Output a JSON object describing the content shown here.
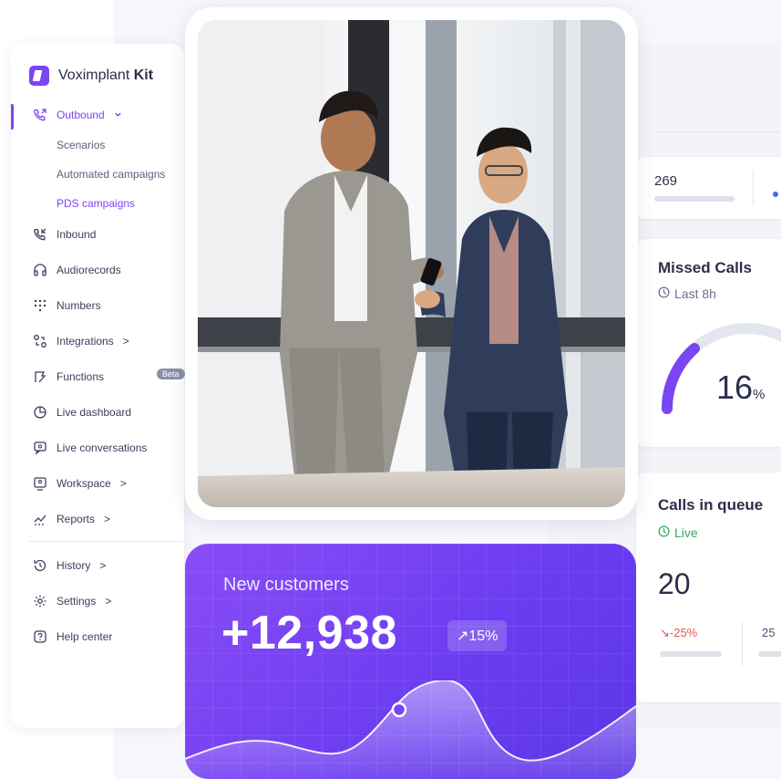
{
  "brand": {
    "name_regular": "Voximplant ",
    "name_bold": "Kit",
    "accent": "#7a45f2"
  },
  "nav": {
    "outbound": {
      "label": "Outbound",
      "sub": [
        "Scenarios",
        "Automated campaigns",
        "PDS campaigns"
      ]
    },
    "inbound": "Inbound",
    "audiorecords": "Audiorecords",
    "numbers": "Numbers",
    "integrations": "Integrations",
    "functions": "Functions",
    "functions_badge": "Beta",
    "live_dashboard": "Live dashboard",
    "live_conversations": "Live conversations",
    "workspace": "Workspace",
    "reports": "Reports",
    "history": "History",
    "settings": "Settings",
    "help_center": "Help center",
    "chevron_right": ">"
  },
  "dashboard": {
    "stat_top": {
      "value": "269"
    },
    "missed_calls": {
      "title": "Missed Calls",
      "period": "Last 8h",
      "percent": "16",
      "unit": "%",
      "gauge_fraction": 0.16
    },
    "calls_in_queue": {
      "title": "Calls in queue",
      "status": "Live",
      "value": "20",
      "change": "↘-25%",
      "secondary": "25"
    }
  },
  "new_customers": {
    "label": "New customers",
    "value": "+12,938",
    "change": "↗15%"
  },
  "colors": {
    "purple": "#7a45f2",
    "live_green": "#2fae63",
    "negative_red": "#e0554f"
  }
}
